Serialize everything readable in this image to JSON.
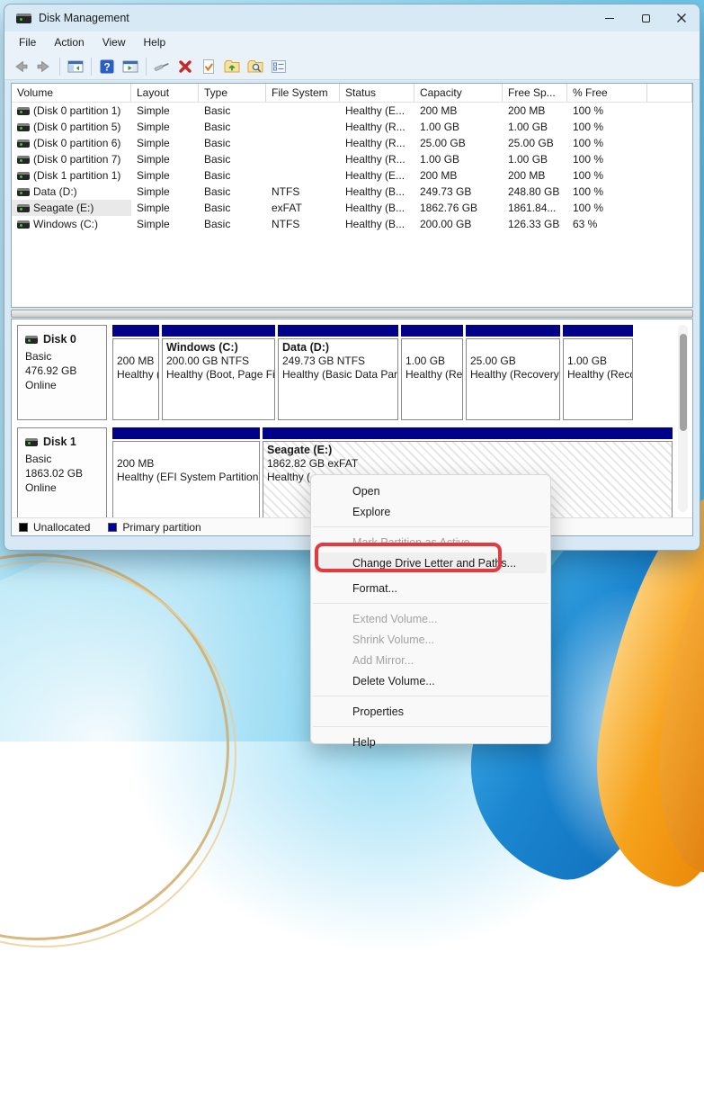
{
  "window": {
    "title": "Disk Management"
  },
  "menu_bar": {
    "items": [
      "File",
      "Action",
      "View",
      "Help"
    ]
  },
  "toolbar": {
    "icons": [
      "back-icon",
      "forward-icon",
      "show-console-tree-icon",
      "help-icon",
      "show-action-pane-icon",
      "screwdriver-icon",
      "delete-partition-icon",
      "check-document-icon",
      "folder-open-icon",
      "folder-explore-icon",
      "properties-icon"
    ]
  },
  "volume_table": {
    "columns": [
      "Volume",
      "Layout",
      "Type",
      "File System",
      "Status",
      "Capacity",
      "Free Sp...",
      "% Free"
    ],
    "rows": [
      {
        "volume": "(Disk 0 partition 1)",
        "layout": "Simple",
        "type": "Basic",
        "fs": "",
        "status": "Healthy (E...",
        "capacity": "200 MB",
        "free": "200 MB",
        "pct": "100 %"
      },
      {
        "volume": "(Disk 0 partition 5)",
        "layout": "Simple",
        "type": "Basic",
        "fs": "",
        "status": "Healthy (R...",
        "capacity": "1.00 GB",
        "free": "1.00 GB",
        "pct": "100 %"
      },
      {
        "volume": "(Disk 0 partition 6)",
        "layout": "Simple",
        "type": "Basic",
        "fs": "",
        "status": "Healthy (R...",
        "capacity": "25.00 GB",
        "free": "25.00 GB",
        "pct": "100 %"
      },
      {
        "volume": "(Disk 0 partition 7)",
        "layout": "Simple",
        "type": "Basic",
        "fs": "",
        "status": "Healthy (R...",
        "capacity": "1.00 GB",
        "free": "1.00 GB",
        "pct": "100 %"
      },
      {
        "volume": "(Disk 1 partition 1)",
        "layout": "Simple",
        "type": "Basic",
        "fs": "",
        "status": "Healthy (E...",
        "capacity": "200 MB",
        "free": "200 MB",
        "pct": "100 %"
      },
      {
        "volume": "Data (D:)",
        "layout": "Simple",
        "type": "Basic",
        "fs": "NTFS",
        "status": "Healthy (B...",
        "capacity": "249.73 GB",
        "free": "248.80 GB",
        "pct": "100 %"
      },
      {
        "volume": "Seagate (E:)",
        "layout": "Simple",
        "type": "Basic",
        "fs": "exFAT",
        "status": "Healthy (B...",
        "capacity": "1862.76 GB",
        "free": "1861.84...",
        "pct": "100 %"
      },
      {
        "volume": "Windows (C:)",
        "layout": "Simple",
        "type": "Basic",
        "fs": "NTFS",
        "status": "Healthy (B...",
        "capacity": "200.00 GB",
        "free": "126.33 GB",
        "pct": "63 %"
      }
    ]
  },
  "graphical_view": {
    "disks": [
      {
        "name": "Disk 0",
        "kind": "Basic",
        "size": "476.92 GB",
        "status": "Online",
        "partitions": [
          {
            "name": "",
            "size_fs": "200 MB",
            "health": "Healthy (EFI System Partition)"
          },
          {
            "name": "Windows (C:)",
            "size_fs": "200.00 GB NTFS",
            "health": "Healthy (Boot, Page File, Crash Dump, Basic Data Partition)"
          },
          {
            "name": "Data (D:)",
            "size_fs": "249.73 GB NTFS",
            "health": "Healthy (Basic Data Partition)"
          },
          {
            "name": "",
            "size_fs": "1.00 GB",
            "health": "Healthy (Recovery Partition)"
          },
          {
            "name": "",
            "size_fs": "25.00 GB",
            "health": "Healthy (Recovery Partition)"
          },
          {
            "name": "",
            "size_fs": "1.00 GB",
            "health": "Healthy (Recovery Partition)"
          }
        ]
      },
      {
        "name": "Disk 1",
        "kind": "Basic",
        "size": "1863.02 GB",
        "status": "Online",
        "partitions": [
          {
            "name": "",
            "size_fs": "200 MB",
            "health": "Healthy (EFI System Partition)"
          },
          {
            "name": "Seagate (E:)",
            "size_fs": "1862.82 GB exFAT",
            "health": "Healthy ("
          }
        ]
      }
    ],
    "legend": [
      {
        "label": "Unallocated",
        "color": "#000000"
      },
      {
        "label": "Primary partition",
        "color": "#0000a0"
      }
    ]
  },
  "context_menu": {
    "items": [
      {
        "label": "Open"
      },
      {
        "label": "Explore"
      },
      {
        "type": "separator"
      },
      {
        "label": "Mark Partition as Active",
        "disabled": true
      },
      {
        "label": "Change Drive Letter and Paths...",
        "highlighted": true
      },
      {
        "label": "Format..."
      },
      {
        "type": "separator"
      },
      {
        "label": "Extend Volume...",
        "disabled": true
      },
      {
        "label": "Shrink Volume...",
        "disabled": true
      },
      {
        "label": "Add Mirror...",
        "disabled": true
      },
      {
        "label": "Delete Volume..."
      },
      {
        "type": "separator"
      },
      {
        "label": "Properties"
      },
      {
        "type": "separator"
      },
      {
        "label": "Help"
      }
    ]
  },
  "annotation": {
    "shape": "red-box",
    "color": "#e23a3f",
    "target": "Change Drive Letter and Paths..."
  },
  "colors": {
    "partition_strip": "#000089",
    "titlebar_bg": "#d7e9f4",
    "selection_hatch": "#e7e7e7"
  }
}
